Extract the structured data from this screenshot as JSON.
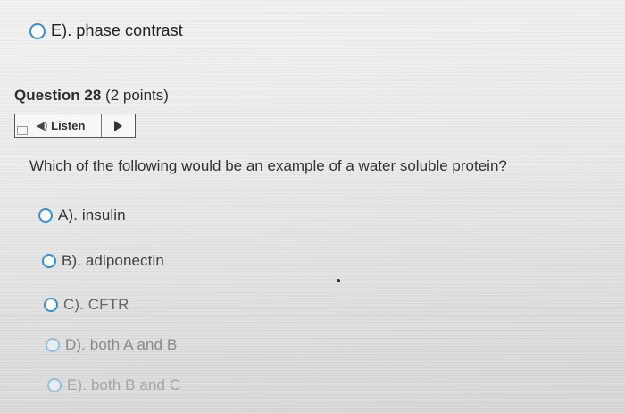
{
  "previous_question": {
    "answer_label": "E). phase contrast"
  },
  "question": {
    "title_bold": "Question 28",
    "title_points": "(2 points)",
    "listen_label": "Listen",
    "text": "Which of the following would be an example of a water soluble protein?",
    "options": [
      {
        "label": "A). insulin"
      },
      {
        "label": "B). adiponectin"
      },
      {
        "label": "C). CFTR"
      },
      {
        "label": "D). both A and B"
      },
      {
        "label": "E). both B and C"
      }
    ]
  },
  "icons": {
    "speaker": "speaker-icon",
    "play": "play-icon"
  },
  "colors": {
    "radio_border": "#3a8fc8"
  }
}
